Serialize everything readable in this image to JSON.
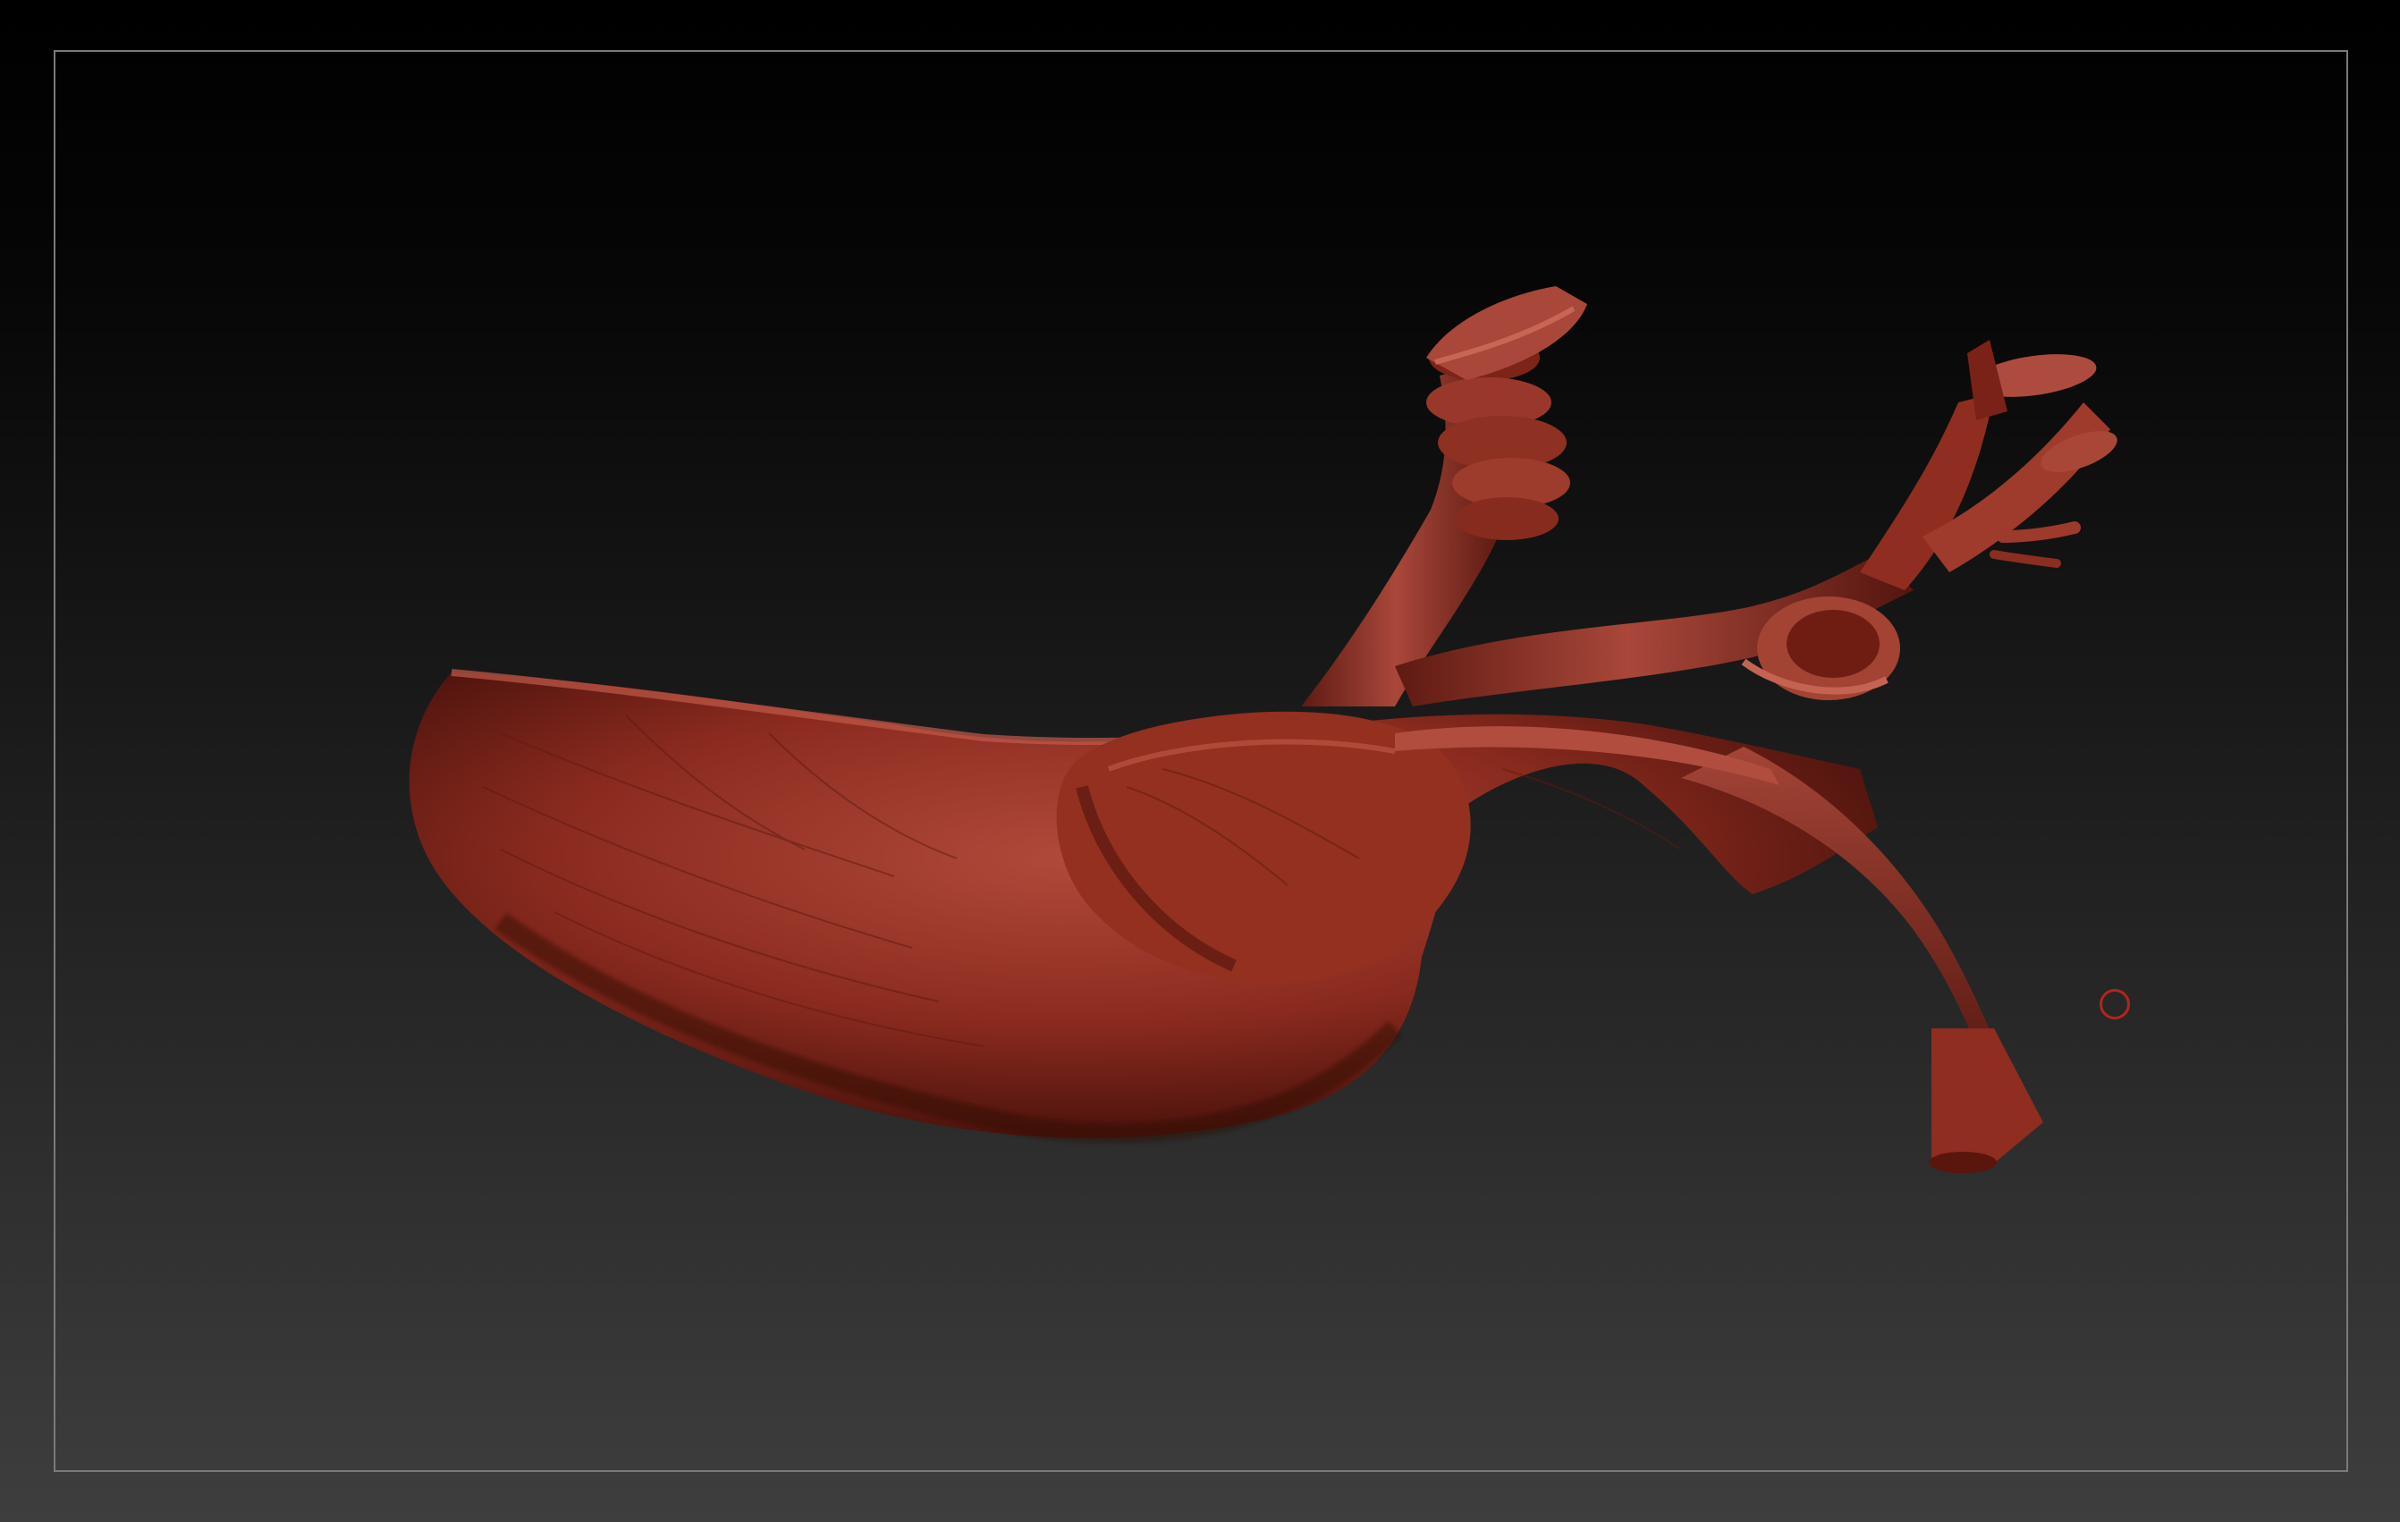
{
  "viewport": {
    "background_top": "#000000",
    "background_bottom": "#3e3e3e",
    "frame_color": "#7a7a7a"
  },
  "model": {
    "material_color": "#8a2a1e",
    "highlight_color": "#b2493a",
    "shadow_color": "#3a0d08"
  },
  "brush": {
    "cursor_color": "#b3241f"
  }
}
